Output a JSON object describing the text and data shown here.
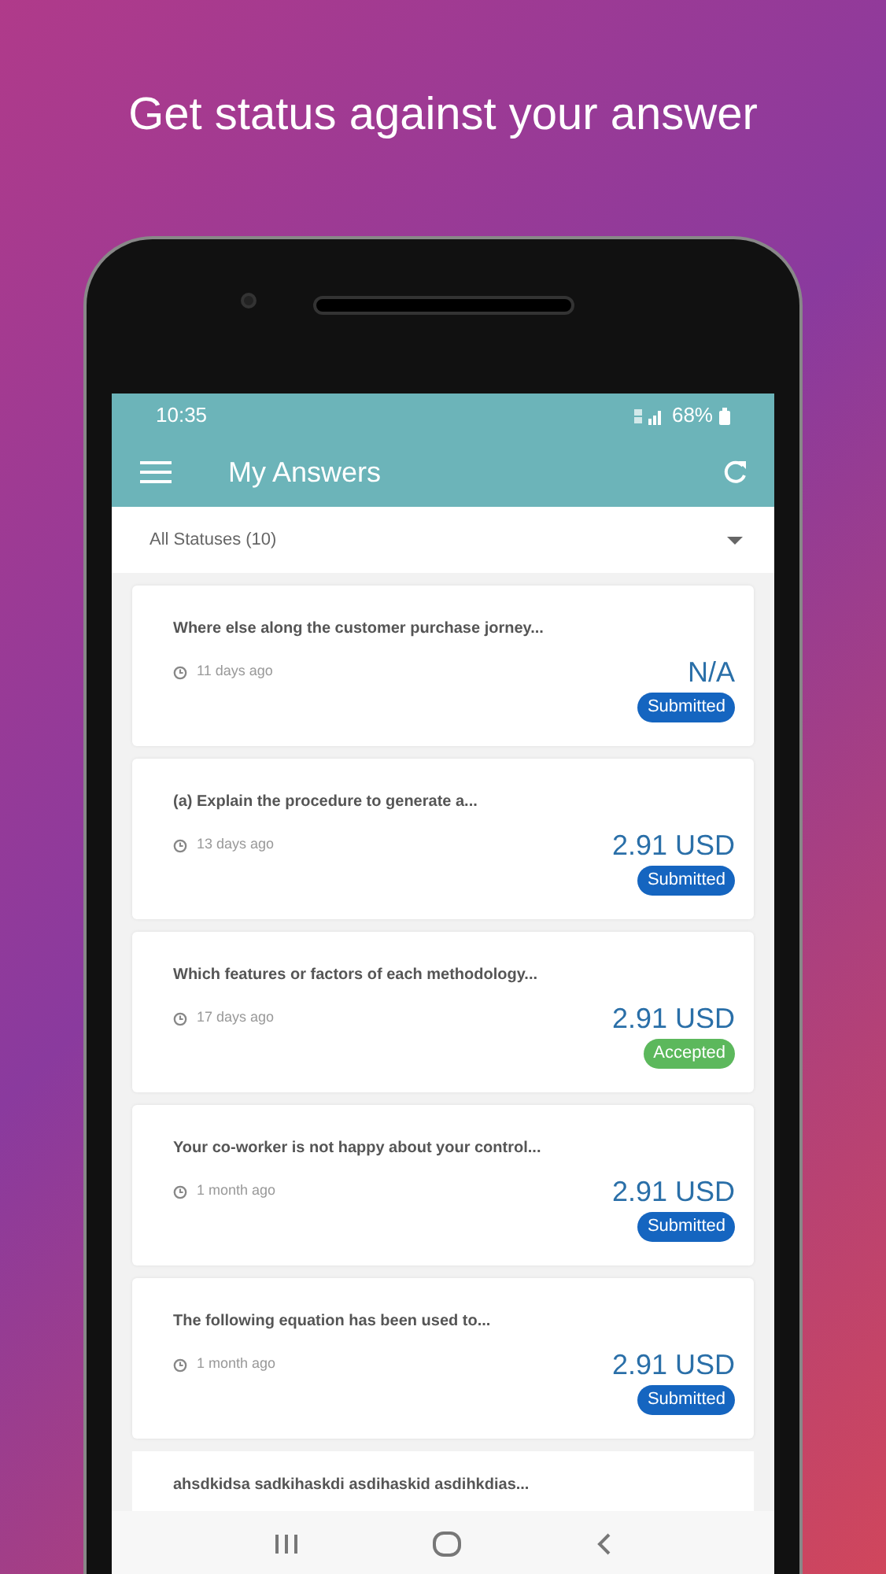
{
  "headline": "Get status against your answer",
  "status_bar": {
    "time": "10:35",
    "battery": "68%"
  },
  "app_bar": {
    "title": "My Answers"
  },
  "filter": {
    "label": "All Statuses (10)"
  },
  "answers": [
    {
      "question": "Where else along the customer purchase jorney...",
      "time": "11 days ago",
      "amount": "N/A",
      "status": "Submitted",
      "kind": "submitted"
    },
    {
      "question": "(a) Explain the procedure to generate a...",
      "time": "13 days ago",
      "amount": "2.91 USD",
      "status": "Submitted",
      "kind": "submitted"
    },
    {
      "question": "Which features or factors of each methodology...",
      "time": "17 days ago",
      "amount": "2.91 USD",
      "status": "Accepted",
      "kind": "accepted"
    },
    {
      "question": "Your co-worker is not happy about your control...",
      "time": "1 month ago",
      "amount": "2.91 USD",
      "status": "Submitted",
      "kind": "submitted"
    },
    {
      "question": "The following equation has been used to...",
      "time": "1 month ago",
      "amount": "2.91 USD",
      "status": "Submitted",
      "kind": "submitted"
    }
  ],
  "partial_answer": {
    "question": "ahsdkidsa sadkihaskdi asdihaskid asdihkdias..."
  }
}
